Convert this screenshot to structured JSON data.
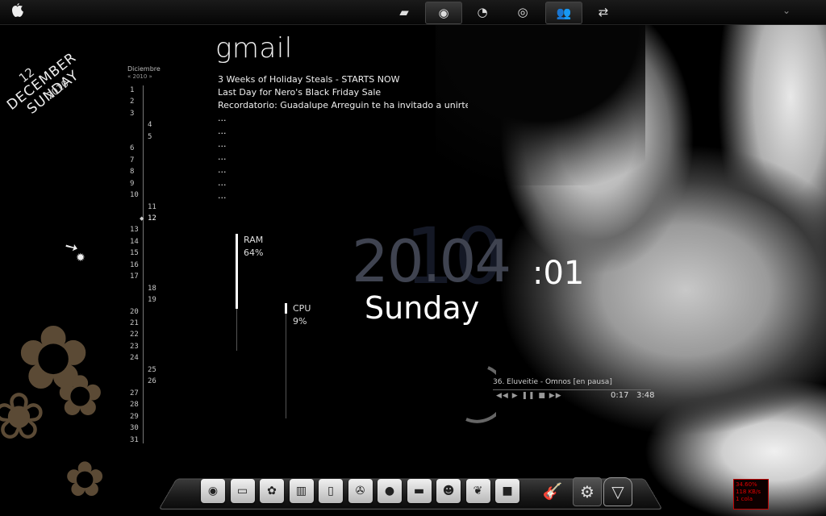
{
  "topbar": {
    "apple_icon": "apple-icon",
    "buttons": [
      {
        "icon": "folder-icon",
        "glyph": "▰"
      },
      {
        "icon": "firefox-icon",
        "glyph": "◉"
      },
      {
        "icon": "clock-icon",
        "glyph": "◔"
      },
      {
        "icon": "media-player-icon",
        "glyph": "◎"
      },
      {
        "icon": "messenger-icon",
        "glyph": "👥"
      },
      {
        "icon": "network-icon",
        "glyph": "⇄"
      }
    ],
    "right_glyph": "⌄"
  },
  "rotated_date": {
    "day": "12",
    "month": "DECEMBER",
    "weekday": "SUNDAY",
    "year": "2010"
  },
  "calendar": {
    "month": "Diciembre",
    "year_nav": "« 2010 »",
    "selected_day": "12",
    "days": [
      "1",
      "2",
      "3",
      "4",
      "5",
      "6",
      "7",
      "8",
      "9",
      "10",
      "11",
      "12",
      "13",
      "14",
      "15",
      "16",
      "17",
      "18",
      "19",
      "20",
      "21",
      "22",
      "23",
      "24",
      "25",
      "26",
      "27",
      "28",
      "29",
      "30",
      "31"
    ],
    "right_column_days": [
      "4",
      "5",
      "11",
      "12",
      "18",
      "19",
      "25",
      "26"
    ]
  },
  "gmail": {
    "title": "gmail",
    "items": [
      "3 Weeks of Holiday Steals - STARTS NOW",
      "Last Day for Nero's Black Friday Sale",
      "Recordatorio: Guadalupe Arreguin te ha invitado a unirte a Facebo...",
      "...",
      "...",
      "...",
      "...",
      "...",
      "...",
      "..."
    ]
  },
  "ram": {
    "label": "RAM",
    "value": "64%",
    "level": 0.64
  },
  "cpu": {
    "label": "CPU",
    "value": "9%",
    "level": 0.09
  },
  "clock": {
    "time": "20.04",
    "shadow": "10",
    "seconds": ":01",
    "day": "Sunday"
  },
  "player": {
    "track": "36. Eluveitie - Omnos [en pausa]",
    "controls": "◀◀ ▶ ❚❚ ■ ▶▶",
    "position": "0:17",
    "duration": "3:48"
  },
  "dock": {
    "icons": [
      {
        "name": "firefox-icon",
        "glyph": "◉"
      },
      {
        "name": "computer-icon",
        "glyph": "▭"
      },
      {
        "name": "paw-icon",
        "glyph": "✿"
      },
      {
        "name": "piano-icon",
        "glyph": "▥"
      },
      {
        "name": "ipod-icon",
        "glyph": "▯"
      },
      {
        "name": "radiation-icon",
        "glyph": "✇"
      },
      {
        "name": "apple-icon",
        "glyph": "●"
      },
      {
        "name": "briefcase-icon",
        "glyph": "▬"
      },
      {
        "name": "user-icon",
        "glyph": "☻"
      },
      {
        "name": "plant-icon",
        "glyph": "❦"
      },
      {
        "name": "video-camera-icon",
        "glyph": "■"
      }
    ],
    "extra_icons": [
      {
        "name": "guitar-icon",
        "glyph": "🎸"
      },
      {
        "name": "settings-gear-icon",
        "glyph": "⚙"
      },
      {
        "name": "trash-icon",
        "glyph": "▽"
      }
    ]
  },
  "network_widget": {
    "line1": "34.60%",
    "line2": "118 KB/s",
    "line3": "1 cola"
  }
}
